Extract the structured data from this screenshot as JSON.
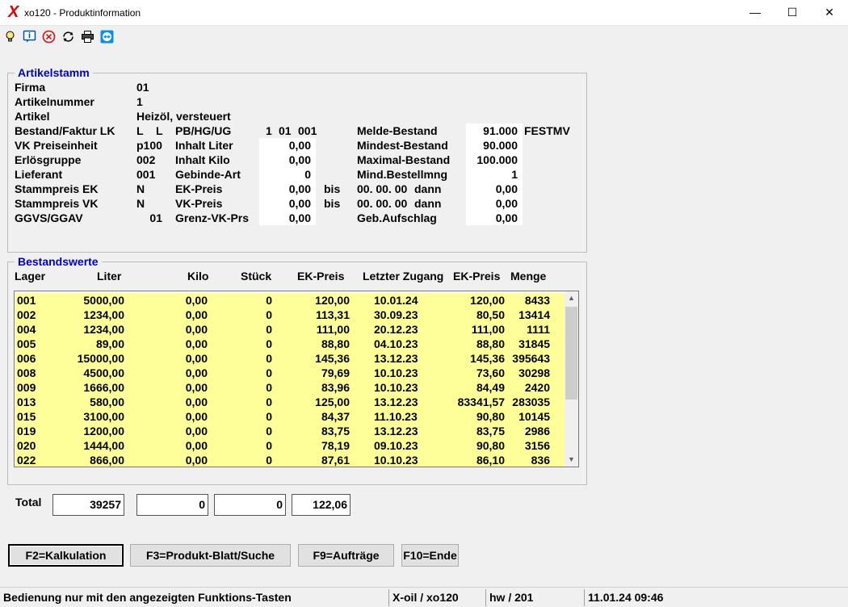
{
  "window": {
    "title": "xo120 - Produktinformation",
    "app_icon_glyph": "X",
    "app_icon_color": "#dd0000",
    "controls": {
      "minimize": "—",
      "maximize": "☐",
      "close": "✕"
    }
  },
  "toolbar": {
    "icons": [
      "lightbulb-icon",
      "info-icon",
      "cancel-icon",
      "refresh-icon",
      "print-icon",
      "teamviewer-icon"
    ]
  },
  "artikelstamm": {
    "legend": "Artikelstamm",
    "firma_label": "Firma",
    "firma": "01",
    "artikelnummer_label": "Artikelnummer",
    "artikelnummer": "1",
    "artikel_label": "Artikel",
    "artikel": "Heizöl, versteuert",
    "bestand_label": "Bestand/Faktur LK",
    "bestand_l1": "L",
    "bestand_l2": "L",
    "pb_label": "PB/HG/UG",
    "pb_1": "1",
    "pb_2": "01",
    "pb_3": "001",
    "melde_label": "Melde-Bestand",
    "melde": "91.000",
    "melde_suffix": "FESTMV",
    "vk_pe_label": "VK Preiseinheit",
    "vk_pe": "p100",
    "inhalt_liter_label": "Inhalt Liter",
    "inhalt_liter": "0,00",
    "mindest_label": "Mindest-Bestand",
    "mindest": "90.000",
    "erloes_label": "Erlösgruppe",
    "erloes": "002",
    "inhalt_kilo_label": "Inhalt Kilo",
    "inhalt_kilo": "0,00",
    "maximal_label": "Maximal-Bestand",
    "maximal": "100.000",
    "lieferant_label": "Lieferant",
    "lieferant": "001",
    "gebinde_label": "Gebinde-Art",
    "gebinde": "0",
    "mind_best_label": "Mind.Bestellmng",
    "mind_best": "1",
    "sp_ek_label": "Stammpreis EK",
    "sp_ek": "N",
    "ek_preis_label": "EK-Preis",
    "ek_preis": "0,00",
    "bis_label": "bis",
    "ek_bis_date": "00. 00. 00",
    "dann_label": "dann",
    "ek_dann": "0,00",
    "sp_vk_label": "Stammpreis VK",
    "sp_vk": "N",
    "vk_preis_label": "VK-Preis",
    "vk_preis": "0,00",
    "vk_bis_date": "00. 00. 00",
    "vk_dann": "0,00",
    "ggvs_label": "GGVS/GGAV",
    "ggvs": "01",
    "grenz_label": "Grenz-VK-Prs",
    "grenz": "0,00",
    "geb_auf_label": "Geb.Aufschlag",
    "geb_auf": "0,00"
  },
  "bestandswerte": {
    "legend": "Bestandswerte",
    "columns": [
      "Lager",
      "Liter",
      "Kilo",
      "Stück",
      "EK-Preis",
      "Letzter Zugang",
      "EK-Preis",
      "Menge"
    ],
    "rows": [
      [
        "001",
        "5000,00",
        "0,00",
        "0",
        "120,00",
        "10.01.24",
        "120,00",
        "8433"
      ],
      [
        "002",
        "1234,00",
        "0,00",
        "0",
        "113,31",
        "30.09.23",
        "80,50",
        "13414"
      ],
      [
        "004",
        "1234,00",
        "0,00",
        "0",
        "111,00",
        "20.12.23",
        "111,00",
        "1111"
      ],
      [
        "005",
        "89,00",
        "0,00",
        "0",
        "88,80",
        "04.10.23",
        "88,80",
        "31845"
      ],
      [
        "006",
        "15000,00",
        "0,00",
        "0",
        "145,36",
        "13.12.23",
        "145,36",
        "395643"
      ],
      [
        "008",
        "4500,00",
        "0,00",
        "0",
        "79,69",
        "10.10.23",
        "73,60",
        "30298"
      ],
      [
        "009",
        "1666,00",
        "0,00",
        "0",
        "83,96",
        "10.10.23",
        "84,49",
        "2420"
      ],
      [
        "013",
        "580,00",
        "0,00",
        "0",
        "125,00",
        "13.12.23",
        "83341,57",
        "283035"
      ],
      [
        "015",
        "3100,00",
        "0,00",
        "0",
        "84,37",
        "11.10.23",
        "90,80",
        "10145"
      ],
      [
        "019",
        "1200,00",
        "0,00",
        "0",
        "83,75",
        "13.12.23",
        "83,75",
        "2986"
      ],
      [
        "020",
        "1444,00",
        "0,00",
        "0",
        "78,19",
        "09.10.23",
        "90,80",
        "3156"
      ],
      [
        "022",
        "866,00",
        "0,00",
        "0",
        "87,61",
        "10.10.23",
        "86,10",
        "836"
      ]
    ],
    "row_color": "#ffff99"
  },
  "totals": {
    "label": "Total",
    "liter": "39257",
    "kilo": "0",
    "stueck": "0",
    "ek_preis": "122,06"
  },
  "buttons": {
    "f2": "F2=Kalkulation",
    "f3": "F3=Produkt-Blatt/Suche",
    "f9": "F9=Aufträge",
    "f10": "F10=Ende"
  },
  "status": {
    "message": "Bedienung nur mit den angezeigten Funktions-Tasten",
    "app": "X-oil / xo120",
    "user": "hw / 201",
    "datetime": "11.01.24 09:46"
  }
}
